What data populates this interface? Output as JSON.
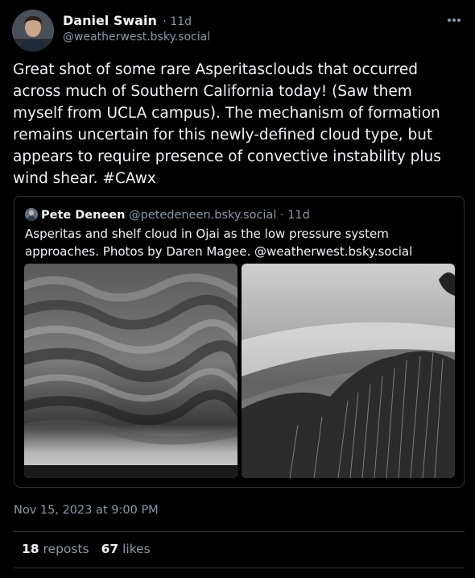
{
  "post": {
    "author_name": "Daniel Swain",
    "time": "· 11d",
    "handle": "@weatherwest.bsky.social",
    "more_icon": "more-dots-icon",
    "text": "Great shot of some rare Asperitasclouds that occurred across much of Southern California today! (Saw them myself from UCLA campus). The mechanism of formation remains uncertain for this newly-defined cloud type, but appears to require presence of convective instability plus wind shear. #CAwx"
  },
  "quote": {
    "author_name": "Pete Deneen",
    "meta": "@petedeneen.bsky.social · 11d",
    "text": "Asperitas and shelf cloud in Ojai as the low pressure system approaches. Photos by Daren Magee. @weatherwest.bsky.social"
  },
  "timestamp": "Nov 15, 2023 at 9:00 PM",
  "stats": {
    "reposts_count": "18",
    "reposts_label": "reposts",
    "likes_count": "67",
    "likes_label": "likes"
  }
}
